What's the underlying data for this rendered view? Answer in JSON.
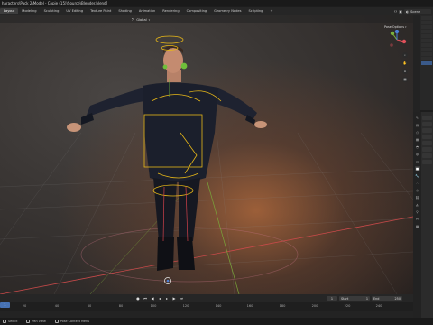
{
  "window": {
    "title": "haracters\\Pack 2\\Model - Copie (15)\\Source\\Blender.blend]"
  },
  "workspaces": {
    "tabs": [
      {
        "label": "Layout",
        "active": true
      },
      {
        "label": "Modeling",
        "active": false
      },
      {
        "label": "Sculpting",
        "active": false
      },
      {
        "label": "UV Editing",
        "active": false
      },
      {
        "label": "Texture Paint",
        "active": false
      },
      {
        "label": "Shading",
        "active": false
      },
      {
        "label": "Animation",
        "active": false
      },
      {
        "label": "Rendering",
        "active": false
      },
      {
        "label": "Compositing",
        "active": false
      },
      {
        "label": "Geometry Nodes",
        "active": false
      },
      {
        "label": "Scripting",
        "active": false
      },
      {
        "label": "+",
        "active": false
      }
    ],
    "scene_label": "Scene"
  },
  "viewport": {
    "pose_options_label": "Pose Options",
    "gizmo_axes": {
      "x": "X",
      "y": "Y",
      "z": "Z"
    },
    "colors": {
      "x_axis": "#e0505a",
      "y_axis": "#7ab23c",
      "z_axis": "#4a7fd6",
      "selection": "#e8b818",
      "accent": "#4772b3"
    }
  },
  "timeline": {
    "mode_label": "Global",
    "current_frame": "1",
    "start_label": "Start",
    "start_value": "1",
    "end_label": "End",
    "end_value": "250",
    "ruler": [
      "20",
      "40",
      "60",
      "80",
      "100",
      "120",
      "140",
      "160",
      "180",
      "200",
      "220",
      "240"
    ]
  },
  "statusbar": {
    "items": [
      "Select",
      "Pan View",
      "Pose Context Menu"
    ]
  }
}
